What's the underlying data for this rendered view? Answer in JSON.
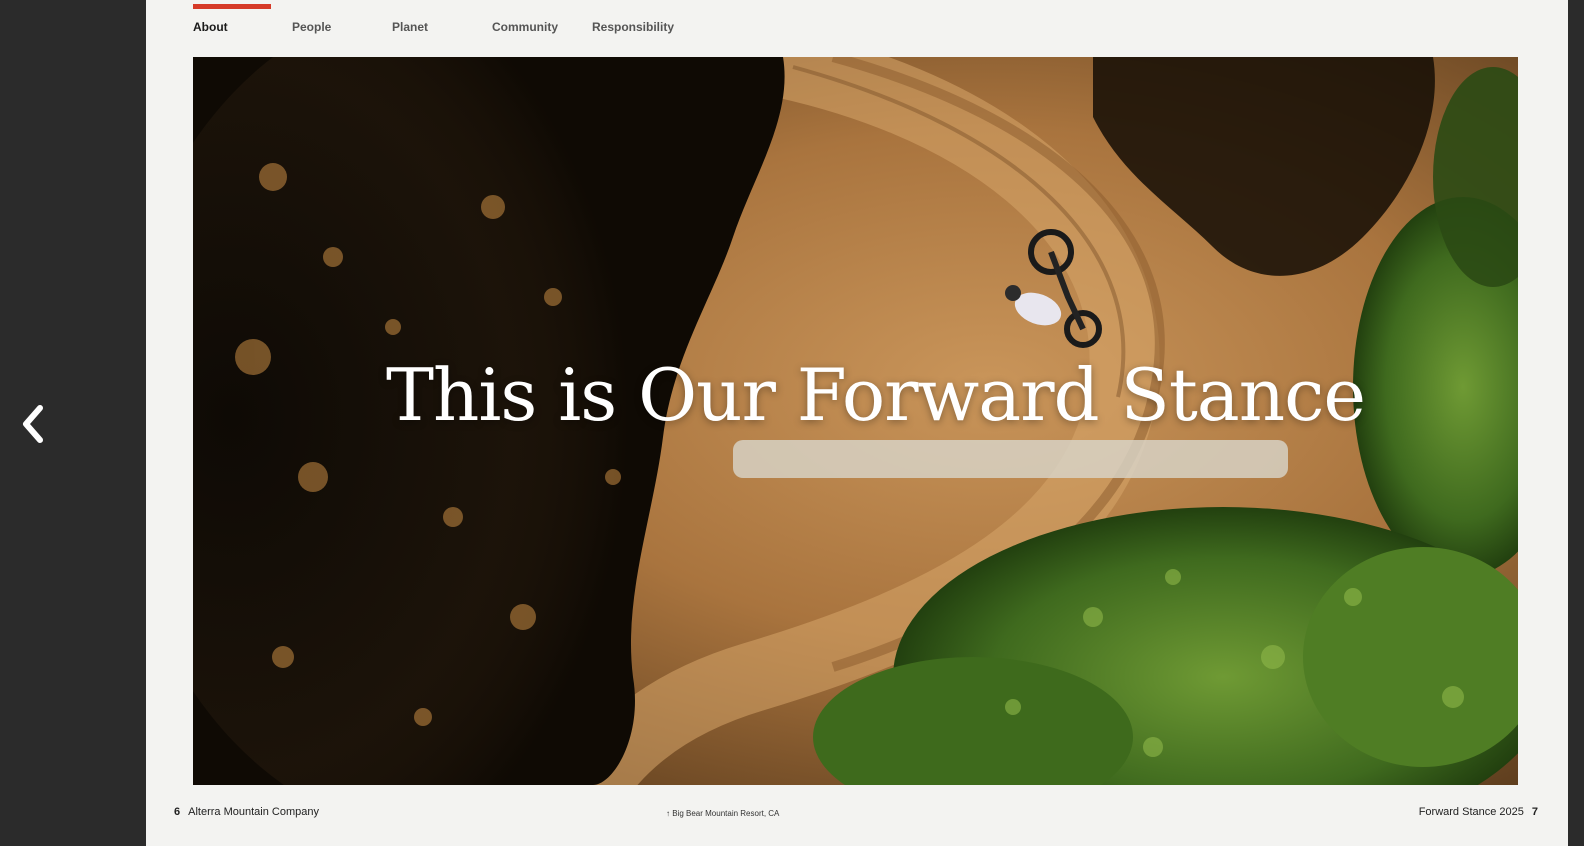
{
  "nav": {
    "items": [
      {
        "label": "About",
        "active": true
      },
      {
        "label": "People",
        "active": false
      },
      {
        "label": "Planet",
        "active": false
      },
      {
        "label": "Community",
        "active": false
      },
      {
        "label": "Responsibility",
        "active": false
      }
    ]
  },
  "hero": {
    "headline": "This is Our Forward Stance"
  },
  "footer": {
    "left_page": "6",
    "left_text": "Alterra Mountain Company",
    "caption": "↑ Big Bear Mountain Resort, CA",
    "right_text": "Forward Stance 2025",
    "right_page": "7"
  },
  "icons": {
    "prev": "chevron-left-icon"
  },
  "colors": {
    "accent": "#d63a28",
    "page_bg": "#f3f3f1",
    "viewer_bg": "#2b2b2b"
  }
}
